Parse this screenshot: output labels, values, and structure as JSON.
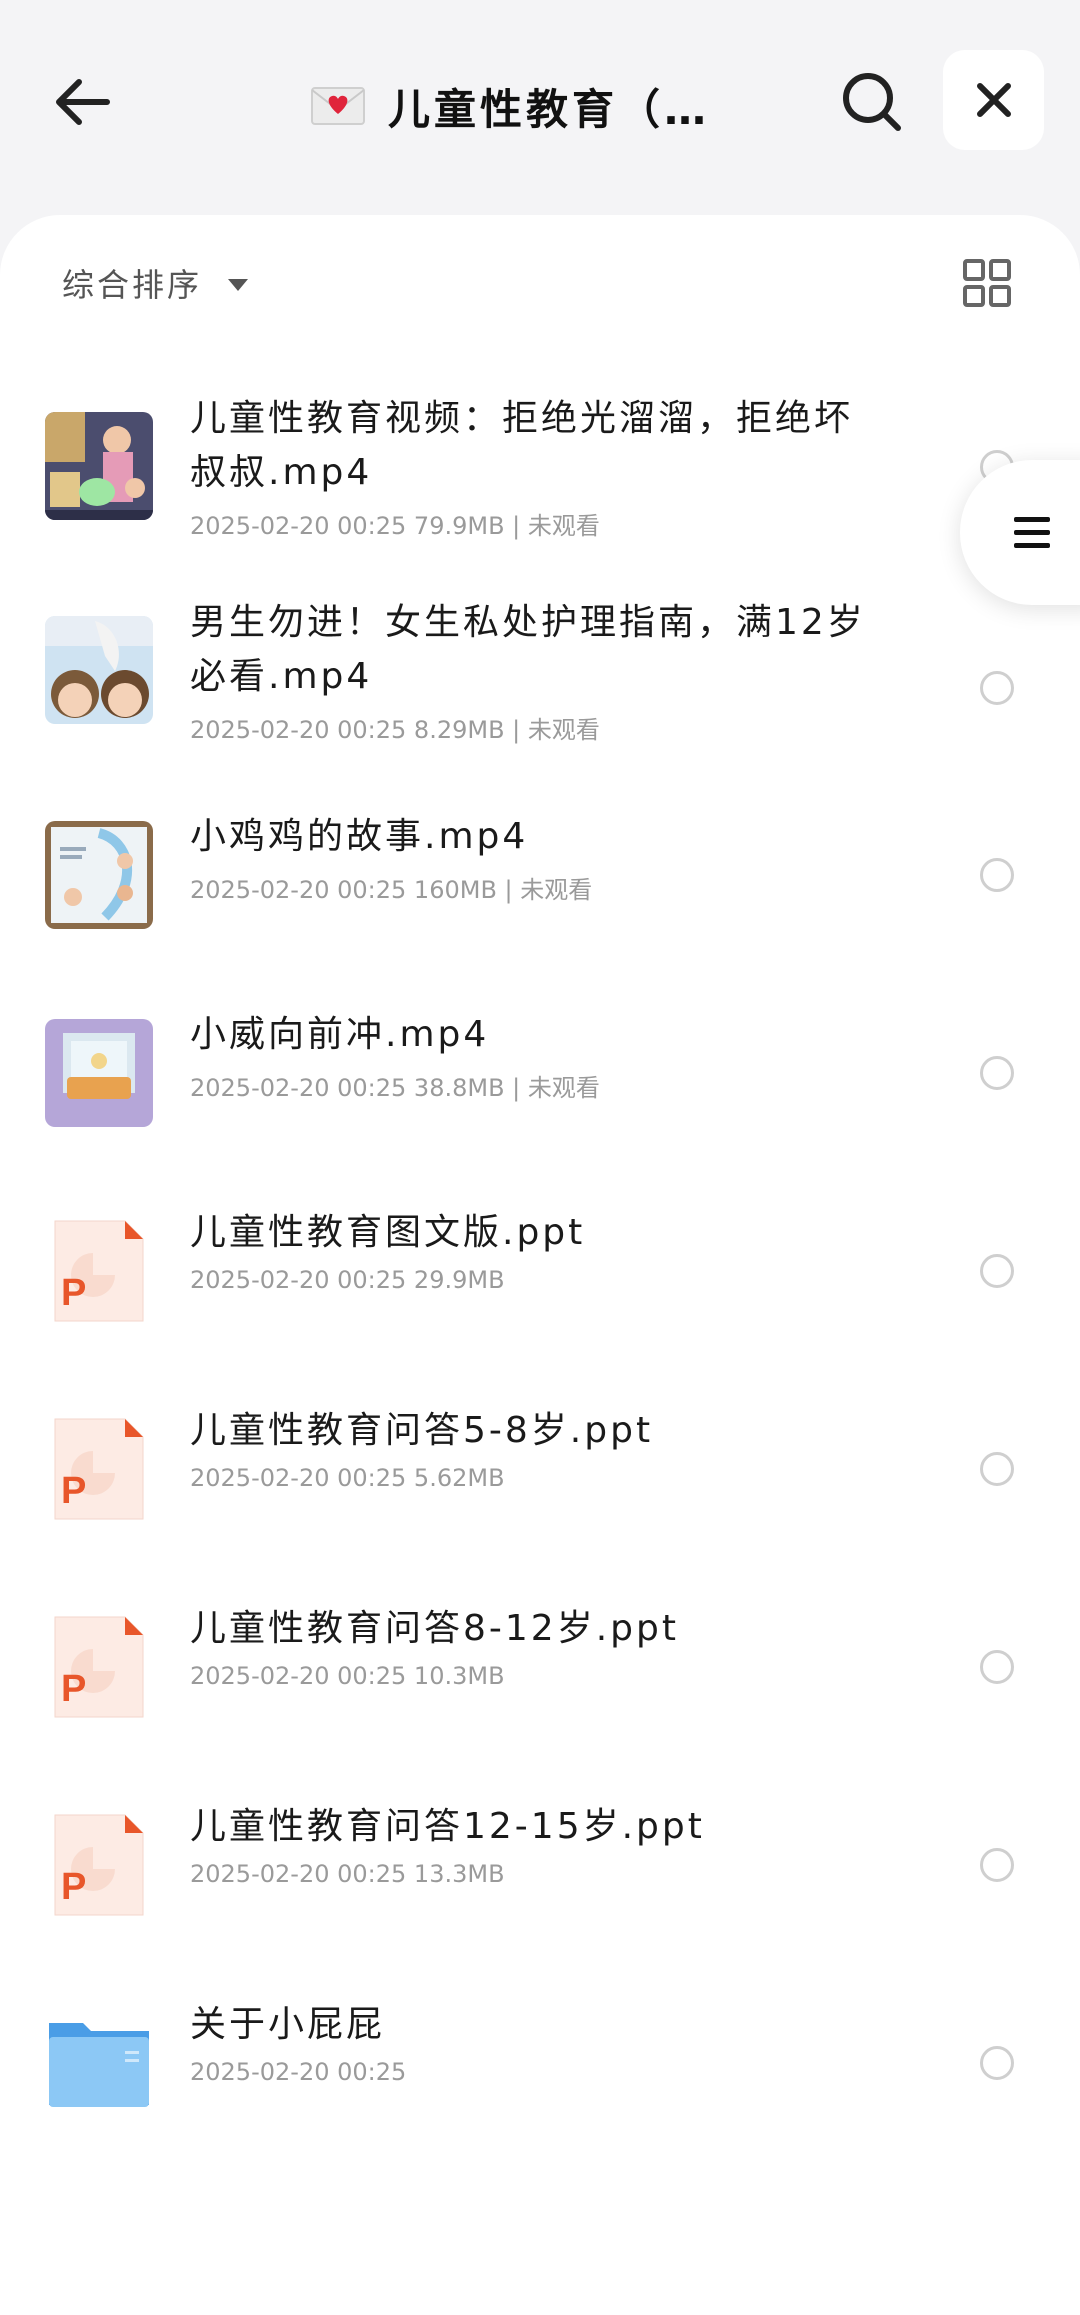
{
  "header": {
    "title": "儿童性教育（…",
    "back_icon": "arrow-left-icon",
    "search_icon": "search-icon",
    "close_icon": "close-icon"
  },
  "toolbar": {
    "sort_label": "综合排序",
    "view_toggle_icon": "grid-view-icon"
  },
  "floating_menu_icon": "menu-icon",
  "files": [
    {
      "name": "儿童性教育视频：拒绝光溜溜，拒绝坏叔叔.mp4",
      "date": "2025-02-20 00:25",
      "size": "79.9MB",
      "status": "未观看",
      "type": "video"
    },
    {
      "name": "男生勿进！女生私处护理指南，满12岁必看.mp4",
      "date": "2025-02-20 00:25",
      "size": "8.29MB",
      "status": "未观看",
      "type": "video"
    },
    {
      "name": "小鸡鸡的故事.mp4",
      "date": "2025-02-20 00:25",
      "size": "160MB",
      "status": "未观看",
      "type": "video"
    },
    {
      "name": "小威向前冲.mp4",
      "date": "2025-02-20 00:25",
      "size": "38.8MB",
      "status": "未观看",
      "type": "video"
    },
    {
      "name": "儿童性教育图文版.ppt",
      "date": "2025-02-20 00:25",
      "size": "29.9MB",
      "status": "",
      "type": "ppt"
    },
    {
      "name": "儿童性教育问答5-8岁.ppt",
      "date": "2025-02-20 00:25",
      "size": "5.62MB",
      "status": "",
      "type": "ppt"
    },
    {
      "name": "儿童性教育问答8-12岁.ppt",
      "date": "2025-02-20 00:25",
      "size": "10.3MB",
      "status": "",
      "type": "ppt"
    },
    {
      "name": "儿童性教育问答12-15岁.ppt",
      "date": "2025-02-20 00:25",
      "size": "13.3MB",
      "status": "",
      "type": "ppt"
    },
    {
      "name": "关于小屁屁",
      "date": "2025-02-20 00:25",
      "size": "",
      "status": "",
      "type": "folder"
    }
  ],
  "colors": {
    "ppt_accent": "#e8562a",
    "folder_blue": "#6fb6f2",
    "background": "#f4f4f6"
  }
}
